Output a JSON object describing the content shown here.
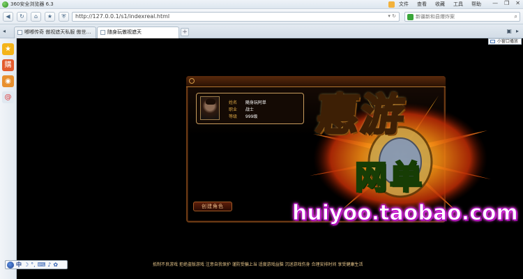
{
  "browser": {
    "title": "360安全浏览器 6.3",
    "menu": [
      "文件",
      "查看",
      "收藏",
      "工具",
      "帮助"
    ],
    "window_controls": [
      "—",
      "❐",
      "✕"
    ]
  },
  "address_bar": {
    "url": "http://127.0.0.1/s1/indexreal.html",
    "search_placeholder": "新疆新和县爆炸案"
  },
  "tabs": [
    {
      "label": "嘟嘟传奇 傲视遮天私服 傲世…",
      "active": false
    },
    {
      "label": "随身玩傲视遮天",
      "active": true
    }
  ],
  "subbar": {
    "mini_play_label": "小窗口播放"
  },
  "sidebar": {
    "items": [
      {
        "icon": "star-icon",
        "color": "#f4b41a"
      },
      {
        "icon": "shopping-icon",
        "color": "#e35b2d"
      },
      {
        "icon": "weibo-icon",
        "color": "#e8902f"
      },
      {
        "icon": "email-icon",
        "color": "#e0e8f0"
      }
    ]
  },
  "game": {
    "character": {
      "name_label": "姓名",
      "name_value": "随身玩阿单",
      "class_label": "职业",
      "class_value": "战士",
      "level_label": "等级",
      "level_value": "999级"
    },
    "create_button": "创建角色"
  },
  "watermark": {
    "line1": "惠游",
    "line2": "网单",
    "url": "huiyoo.taobao.com"
  },
  "footer": {
    "notice": "抵制不良游戏 拒绝盗版游戏 注意自我保护 谨防受骗上当 适度游戏益脑 沉迷游戏伤身 合理安排时间 享受健康生活"
  },
  "ime": {
    "mode": "中"
  }
}
